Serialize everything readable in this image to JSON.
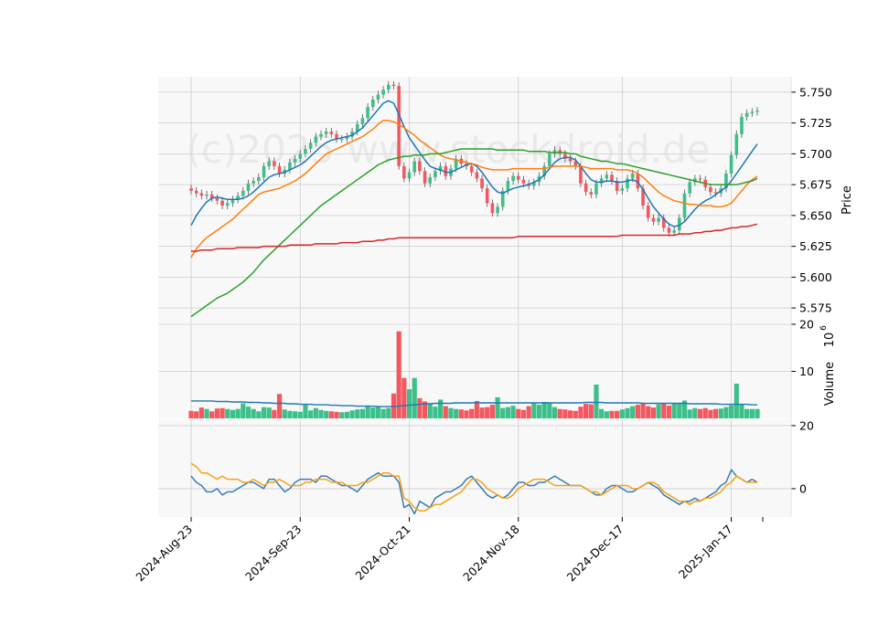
{
  "watermark": "(c)2025 www.stockdroid.de",
  "colors": {
    "up": "#3dbf8a",
    "down": "#f4575f",
    "panel_bg": "#f8f8f8",
    "grid": "#cccccc",
    "sma_short": "#1f77b4",
    "sma_mid": "#ff7f0e",
    "sma_long": "#2ca02c",
    "sma_200": "#d62728",
    "osc_fast": "#3a7cb5",
    "osc_slow": "#f5a214"
  },
  "chart_data": [
    {
      "type": "candlestick",
      "panel": "price",
      "ylabel": "Price",
      "ylim": [
        5.5625,
        5.7625
      ],
      "y_ticks": [
        "5.575",
        "5.600",
        "5.625",
        "5.650",
        "5.675",
        "5.700",
        "5.725",
        "5.750"
      ],
      "x_ticks": [
        "2024-Aug-23",
        "2024-Sep-23",
        "2024-Oct-21",
        "2024-Nov-18",
        "2024-Dec-17",
        "2025-Jan-17"
      ],
      "grid": true,
      "close": [
        5.67,
        5.668,
        5.666,
        5.667,
        5.664,
        5.662,
        5.658,
        5.66,
        5.663,
        5.666,
        5.67,
        5.676,
        5.678,
        5.681,
        5.69,
        5.694,
        5.69,
        5.684,
        5.687,
        5.693,
        5.696,
        5.7,
        5.704,
        5.709,
        5.714,
        5.716,
        5.718,
        5.716,
        5.712,
        5.712,
        5.714,
        5.718,
        5.724,
        5.729,
        5.738,
        5.744,
        5.748,
        5.752,
        5.756,
        5.755,
        5.69,
        5.68,
        5.685,
        5.694,
        5.686,
        5.676,
        5.681,
        5.686,
        5.69,
        5.682,
        5.688,
        5.696,
        5.692,
        5.69,
        5.685,
        5.68,
        5.672,
        5.66,
        5.652,
        5.657,
        5.67,
        5.678,
        5.682,
        5.679,
        5.676,
        5.674,
        5.677,
        5.682,
        5.69,
        5.7,
        5.703,
        5.7,
        5.696,
        5.694,
        5.69,
        5.676,
        5.669,
        5.667,
        5.676,
        5.68,
        5.683,
        5.678,
        5.67,
        5.672,
        5.68,
        5.684,
        5.672,
        5.658,
        5.648,
        5.645,
        5.648,
        5.64,
        5.636,
        5.638,
        5.648,
        5.668,
        5.677,
        5.68,
        5.679,
        5.673,
        5.669,
        5.668,
        5.672,
        5.684,
        5.699,
        5.716,
        5.73,
        5.733,
        5.734,
        5.735
      ],
      "series": [
        {
          "name": "",
          "role": "sma_short",
          "values": [
            5.642,
            5.65,
            5.656,
            5.661,
            5.664,
            5.665,
            5.664,
            5.663,
            5.663,
            5.663,
            5.664,
            5.666,
            5.669,
            5.673,
            5.677,
            5.681,
            5.683,
            5.684,
            5.685,
            5.687,
            5.689,
            5.691,
            5.694,
            5.698,
            5.702,
            5.706,
            5.709,
            5.711,
            5.712,
            5.713,
            5.714,
            5.715,
            5.718,
            5.721,
            5.726,
            5.731,
            5.736,
            5.741,
            5.743,
            5.741,
            5.732,
            5.722,
            5.713,
            5.707,
            5.701,
            5.695,
            5.69,
            5.688,
            5.687,
            5.685,
            5.685,
            5.687,
            5.689,
            5.691,
            5.692,
            5.69,
            5.685,
            5.679,
            5.673,
            5.669,
            5.668,
            5.67,
            5.672,
            5.673,
            5.674,
            5.675,
            5.677,
            5.679,
            5.683,
            5.688,
            5.693,
            5.696,
            5.697,
            5.697,
            5.695,
            5.69,
            5.684,
            5.679,
            5.677,
            5.677,
            5.678,
            5.678,
            5.677,
            5.677,
            5.678,
            5.679,
            5.677,
            5.671,
            5.664,
            5.657,
            5.652,
            5.647,
            5.643,
            5.641,
            5.642,
            5.645,
            5.65,
            5.655,
            5.659,
            5.662,
            5.664,
            5.667,
            5.67,
            5.673,
            5.678,
            5.684,
            5.69,
            5.696,
            5.702,
            5.708
          ]
        },
        {
          "name": "",
          "role": "sma_mid",
          "values": [
            5.616,
            5.623,
            5.628,
            5.632,
            5.635,
            5.638,
            5.641,
            5.644,
            5.647,
            5.651,
            5.655,
            5.659,
            5.663,
            5.667,
            5.669,
            5.67,
            5.671,
            5.672,
            5.674,
            5.676,
            5.678,
            5.681,
            5.684,
            5.688,
            5.692,
            5.696,
            5.7,
            5.702,
            5.704,
            5.706,
            5.708,
            5.71,
            5.712,
            5.714,
            5.717,
            5.72,
            5.724,
            5.727,
            5.727,
            5.726,
            5.724,
            5.721,
            5.718,
            5.715,
            5.711,
            5.708,
            5.705,
            5.702,
            5.699,
            5.697,
            5.696,
            5.695,
            5.694,
            5.693,
            5.692,
            5.691,
            5.689,
            5.688,
            5.687,
            5.687,
            5.687,
            5.687,
            5.688,
            5.688,
            5.688,
            5.688,
            5.688,
            5.688,
            5.688,
            5.689,
            5.69,
            5.69,
            5.69,
            5.69,
            5.69,
            5.69,
            5.689,
            5.688,
            5.688,
            5.688,
            5.688,
            5.688,
            5.687,
            5.687,
            5.687,
            5.686,
            5.684,
            5.681,
            5.677,
            5.673,
            5.669,
            5.666,
            5.664,
            5.662,
            5.661,
            5.66,
            5.659,
            5.659,
            5.658,
            5.658,
            5.658,
            5.657,
            5.657,
            5.658,
            5.66,
            5.665,
            5.67,
            5.675,
            5.679,
            5.682
          ]
        },
        {
          "name": "",
          "role": "sma_long",
          "values": [
            5.568,
            5.571,
            5.574,
            5.577,
            5.58,
            5.583,
            5.585,
            5.587,
            5.59,
            5.593,
            5.596,
            5.6,
            5.604,
            5.609,
            5.614,
            5.618,
            5.622,
            5.626,
            5.63,
            5.634,
            5.638,
            5.642,
            5.646,
            5.65,
            5.654,
            5.658,
            5.661,
            5.664,
            5.667,
            5.67,
            5.673,
            5.676,
            5.679,
            5.682,
            5.685,
            5.688,
            5.691,
            5.693,
            5.695,
            5.696,
            5.697,
            5.698,
            5.698,
            5.699,
            5.699,
            5.699,
            5.7,
            5.7,
            5.7,
            5.701,
            5.702,
            5.703,
            5.704,
            5.704,
            5.704,
            5.704,
            5.704,
            5.704,
            5.704,
            5.703,
            5.703,
            5.703,
            5.703,
            5.703,
            5.703,
            5.702,
            5.702,
            5.702,
            5.702,
            5.701,
            5.701,
            5.701,
            5.701,
            5.7,
            5.7,
            5.698,
            5.697,
            5.696,
            5.695,
            5.694,
            5.694,
            5.693,
            5.692,
            5.692,
            5.691,
            5.69,
            5.689,
            5.688,
            5.687,
            5.686,
            5.685,
            5.684,
            5.683,
            5.682,
            5.681,
            5.68,
            5.679,
            5.678,
            5.677,
            5.676,
            5.675,
            5.675,
            5.675,
            5.675,
            5.675,
            5.675,
            5.676,
            5.677,
            5.678,
            5.68
          ]
        },
        {
          "name": "",
          "role": "sma_200",
          "values": [
            5.621,
            5.621,
            5.622,
            5.622,
            5.622,
            5.623,
            5.623,
            5.623,
            5.623,
            5.624,
            5.624,
            5.624,
            5.624,
            5.624,
            5.625,
            5.625,
            5.625,
            5.625,
            5.625,
            5.626,
            5.626,
            5.626,
            5.626,
            5.626,
            5.627,
            5.627,
            5.627,
            5.627,
            5.627,
            5.628,
            5.628,
            5.628,
            5.628,
            5.629,
            5.629,
            5.629,
            5.63,
            5.63,
            5.631,
            5.631,
            5.632,
            5.632,
            5.632,
            5.632,
            5.632,
            5.632,
            5.632,
            5.632,
            5.632,
            5.632,
            5.632,
            5.632,
            5.632,
            5.632,
            5.632,
            5.632,
            5.632,
            5.632,
            5.632,
            5.632,
            5.632,
            5.632,
            5.632,
            5.633,
            5.633,
            5.633,
            5.633,
            5.633,
            5.633,
            5.633,
            5.633,
            5.633,
            5.633,
            5.633,
            5.633,
            5.633,
            5.633,
            5.633,
            5.633,
            5.633,
            5.633,
            5.633,
            5.633,
            5.634,
            5.634,
            5.634,
            5.634,
            5.634,
            5.634,
            5.634,
            5.634,
            5.634,
            5.634,
            5.634,
            5.635,
            5.635,
            5.635,
            5.636,
            5.636,
            5.637,
            5.637,
            5.638,
            5.638,
            5.639,
            5.64,
            5.64,
            5.641,
            5.641,
            5.642,
            5.643
          ]
        }
      ]
    },
    {
      "type": "bar",
      "panel": "volume",
      "ylabel": "Volume",
      "multiplier_label": "10",
      "multiplier_exponent": "6",
      "ylim": [
        0,
        20
      ],
      "y_ticks": [
        "10",
        "20"
      ],
      "values": [
        1.6,
        1.5,
        2.3,
        2.0,
        1.5,
        2.1,
        2.2,
        2.0,
        1.8,
        2.0,
        3.2,
        2.5,
        2.0,
        1.5,
        2.4,
        2.3,
        1.8,
        5.2,
        1.9,
        1.6,
        1.5,
        1.4,
        2.9,
        1.7,
        2.2,
        1.8,
        1.6,
        1.5,
        1.4,
        1.3,
        1.4,
        1.7,
        1.9,
        2.0,
        2.6,
        2.3,
        2.5,
        2.0,
        2.2,
        5.3,
        18.5,
        8.6,
        6.2,
        8.6,
        4.3,
        3.6,
        3.0,
        2.5,
        4.0,
        2.6,
        2.2,
        2.0,
        1.9,
        1.7,
        2.0,
        3.7,
        2.3,
        2.4,
        2.9,
        4.5,
        2.2,
        2.4,
        2.7,
        2.0,
        1.8,
        2.6,
        3.2,
        2.9,
        3.5,
        3.3,
        2.4,
        2.0,
        1.9,
        1.7,
        1.6,
        2.5,
        3.1,
        3.0,
        7.2,
        2.0,
        1.5,
        1.6,
        1.6,
        1.9,
        2.2,
        2.6,
        2.9,
        3.1,
        2.6,
        2.3,
        3.0,
        3.3,
        2.7,
        3.3,
        3.2,
        3.8,
        1.9,
        2.2,
        2.0,
        2.2,
        1.8,
        2.0,
        2.1,
        2.4,
        2.8,
        7.4,
        3.1,
        2.0,
        2.0,
        2.0
      ],
      "series": [
        {
          "name": "",
          "role": "volume_avg",
          "values": [
            3.7,
            3.7,
            3.7,
            3.7,
            3.7,
            3.6,
            3.6,
            3.6,
            3.5,
            3.5,
            3.5,
            3.4,
            3.4,
            3.4,
            3.3,
            3.3,
            3.2,
            3.2,
            3.2,
            3.1,
            3.1,
            3.0,
            3.0,
            3.0,
            2.9,
            2.9,
            2.9,
            2.8,
            2.8,
            2.7,
            2.7,
            2.7,
            2.6,
            2.6,
            2.6,
            2.6,
            2.5,
            2.5,
            2.5,
            2.5,
            2.6,
            2.7,
            2.8,
            2.9,
            3.0,
            3.1,
            3.1,
            3.2,
            3.2,
            3.2,
            3.2,
            3.3,
            3.3,
            3.3,
            3.3,
            3.3,
            3.3,
            3.3,
            3.3,
            3.3,
            3.3,
            3.3,
            3.3,
            3.3,
            3.3,
            3.3,
            3.3,
            3.3,
            3.3,
            3.3,
            3.3,
            3.3,
            3.3,
            3.3,
            3.3,
            3.3,
            3.4,
            3.4,
            3.4,
            3.4,
            3.3,
            3.3,
            3.3,
            3.3,
            3.3,
            3.3,
            3.3,
            3.2,
            3.2,
            3.2,
            3.2,
            3.2,
            3.2,
            3.2,
            3.2,
            3.2,
            3.1,
            3.1,
            3.1,
            3.1,
            3.1,
            3.1,
            3.0,
            3.0,
            3.0,
            3.0,
            3.0,
            3.0,
            2.9,
            2.9
          ]
        }
      ]
    },
    {
      "type": "line",
      "panel": "oscillator",
      "ylim": [
        -9,
        22
      ],
      "y_ticks": [
        "0",
        "20"
      ],
      "series": [
        {
          "name": "",
          "role": "osc_fast",
          "values": [
            4,
            2,
            1,
            -1,
            -1,
            0,
            -2,
            -1,
            -1,
            0,
            1,
            2,
            2,
            1,
            0,
            3,
            3,
            1,
            -1,
            0,
            2,
            3,
            3,
            3,
            2,
            4,
            4,
            3,
            2,
            1,
            1,
            0,
            -1,
            1,
            3,
            4,
            5,
            4,
            4,
            4,
            2,
            -6,
            -5,
            -8,
            -4,
            -5,
            -6,
            -3,
            -2,
            -1,
            -1,
            0,
            1,
            3,
            4,
            2,
            0,
            -2,
            -3,
            -2,
            -3,
            -2,
            0,
            2,
            2,
            1,
            1,
            2,
            2,
            3,
            4,
            3,
            2,
            1,
            1,
            1,
            0,
            -1,
            -2,
            -2,
            0,
            1,
            1,
            0,
            -1,
            -1,
            0,
            1,
            2,
            1,
            0,
            -2,
            -3,
            -4,
            -5,
            -4,
            -4,
            -3,
            -4,
            -3,
            -2,
            -1,
            1,
            2,
            6,
            4,
            3,
            2,
            3,
            2
          ]
        },
        {
          "name": "",
          "role": "osc_slow",
          "values": [
            8,
            7,
            5,
            5,
            4,
            3,
            4,
            3,
            3,
            3,
            2,
            2,
            3,
            2,
            1,
            2,
            2,
            3,
            2,
            1,
            1,
            1,
            2,
            2,
            3,
            3,
            3,
            2,
            2,
            2,
            1,
            1,
            1,
            2,
            2,
            3,
            4,
            5,
            5,
            4,
            4,
            -3,
            -4,
            -6,
            -7,
            -7,
            -6,
            -5,
            -5,
            -4,
            -3,
            -2,
            -1,
            1,
            3,
            3,
            2,
            0,
            -1,
            -2,
            -3,
            -3,
            -2,
            0,
            1,
            2,
            3,
            3,
            3,
            2,
            1,
            1,
            1,
            1,
            1,
            1,
            0,
            -1,
            -1,
            -2,
            -1,
            0,
            1,
            1,
            1,
            0,
            0,
            1,
            2,
            2,
            1,
            -1,
            -2,
            -3,
            -4,
            -4,
            -5,
            -4,
            -4,
            -3,
            -3,
            -2,
            -1,
            1,
            2,
            4,
            3,
            2,
            2,
            2
          ]
        }
      ]
    }
  ]
}
